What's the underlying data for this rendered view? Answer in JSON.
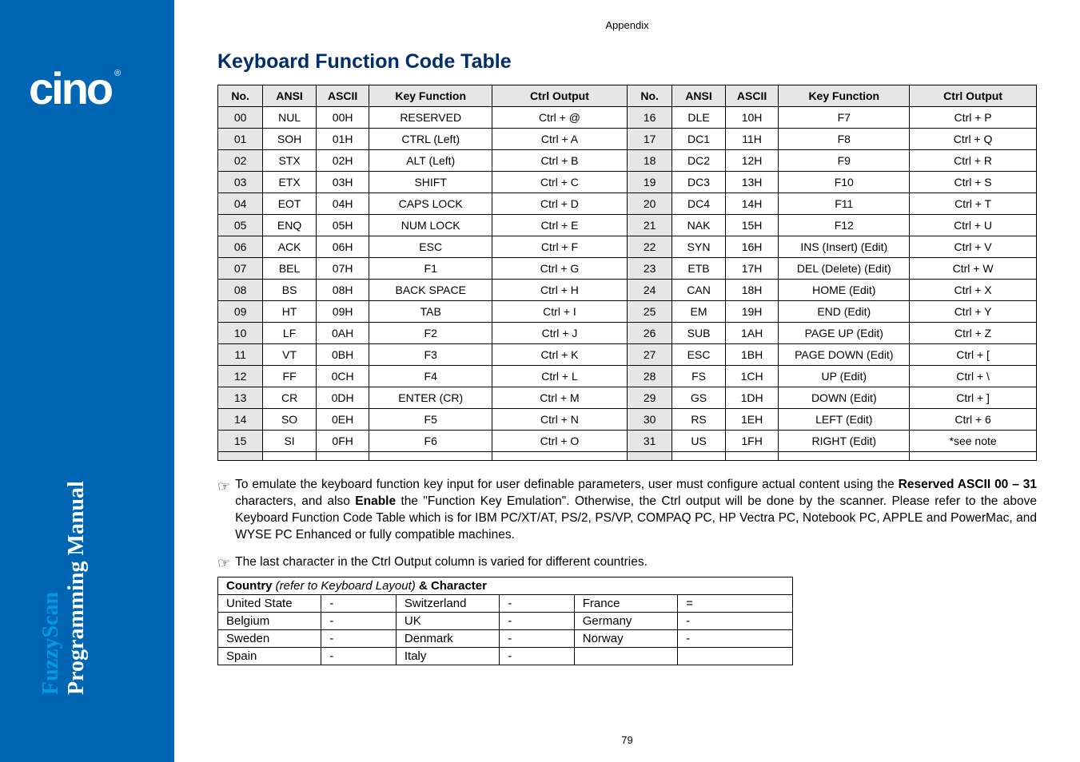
{
  "brand": "cino",
  "reg": "®",
  "manual_line1": "FuzzyScan",
  "manual_line2": "Programming Manual",
  "appendix": "Appendix",
  "title": "Keyboard Function Code Table",
  "headers": [
    "No.",
    "ANSI",
    "ASCII",
    "Key Function",
    "Ctrl Output",
    "No.",
    "ANSI",
    "ASCII",
    "Key Function",
    "Ctrl Output"
  ],
  "rows": [
    [
      "00",
      "NUL",
      "00H",
      "RESERVED",
      "Ctrl + @",
      "16",
      "DLE",
      "10H",
      "F7",
      "Ctrl + P"
    ],
    [
      "01",
      "SOH",
      "01H",
      "CTRL (Left)",
      "Ctrl + A",
      "17",
      "DC1",
      "11H",
      "F8",
      "Ctrl + Q"
    ],
    [
      "02",
      "STX",
      "02H",
      "ALT (Left)",
      "Ctrl + B",
      "18",
      "DC2",
      "12H",
      "F9",
      "Ctrl + R"
    ],
    [
      "03",
      "ETX",
      "03H",
      "SHIFT",
      "Ctrl + C",
      "19",
      "DC3",
      "13H",
      "F10",
      "Ctrl + S"
    ],
    [
      "04",
      "EOT",
      "04H",
      "CAPS LOCK",
      "Ctrl + D",
      "20",
      "DC4",
      "14H",
      "F11",
      "Ctrl + T"
    ],
    [
      "05",
      "ENQ",
      "05H",
      "NUM LOCK",
      "Ctrl + E",
      "21",
      "NAK",
      "15H",
      "F12",
      "Ctrl + U"
    ],
    [
      "06",
      "ACK",
      "06H",
      "ESC",
      "Ctrl + F",
      "22",
      "SYN",
      "16H",
      "INS (Insert) (Edit)",
      "Ctrl + V"
    ],
    [
      "07",
      "BEL",
      "07H",
      "F1",
      "Ctrl + G",
      "23",
      "ETB",
      "17H",
      "DEL (Delete) (Edit)",
      "Ctrl + W"
    ],
    [
      "08",
      "BS",
      "08H",
      "BACK SPACE",
      "Ctrl + H",
      "24",
      "CAN",
      "18H",
      "HOME (Edit)",
      "Ctrl + X"
    ],
    [
      "09",
      "HT",
      "09H",
      "TAB",
      "Ctrl + I",
      "25",
      "EM",
      "19H",
      "END (Edit)",
      "Ctrl + Y"
    ],
    [
      "10",
      "LF",
      "0AH",
      "F2",
      "Ctrl + J",
      "26",
      "SUB",
      "1AH",
      "PAGE UP (Edit)",
      "Ctrl + Z"
    ],
    [
      "11",
      "VT",
      "0BH",
      "F3",
      "Ctrl + K",
      "27",
      "ESC",
      "1BH",
      "PAGE DOWN (Edit)",
      "Ctrl + ["
    ],
    [
      "12",
      "FF",
      "0CH",
      "F4",
      "Ctrl + L",
      "28",
      "FS",
      "1CH",
      "UP (Edit)",
      "Ctrl + \\"
    ],
    [
      "13",
      "CR",
      "0DH",
      "ENTER (CR)",
      "Ctrl + M",
      "29",
      "GS",
      "1DH",
      "DOWN (Edit)",
      "Ctrl + ]"
    ],
    [
      "14",
      "SO",
      "0EH",
      "F5",
      "Ctrl + N",
      "30",
      "RS",
      "1EH",
      "LEFT (Edit)",
      "Ctrl + 6"
    ],
    [
      "15",
      "SI",
      "0FH",
      "F6",
      "Ctrl + O",
      "31",
      "US",
      "1FH",
      "RIGHT (Edit)",
      "*see note"
    ],
    [
      "",
      "",
      "",
      "",
      "",
      "",
      "",
      "",
      "",
      ""
    ]
  ],
  "note1_pre": "To emulate the keyboard function key input for user definable parameters, user must configure actual content using the ",
  "note1_b1": "Reserved ASCII 00 – 31",
  "note1_mid": " characters, and also ",
  "note1_b2": "Enable",
  "note1_post": " the \"Function Key Emulation\". Otherwise, the Ctrl output will be done by the scanner. Please refer to the above Keyboard Function Code Table which is for IBM PC/XT/AT, PS/2, PS/VP, COMPAQ PC, HP Vectra PC, Notebook PC, APPLE and PowerMac, and WYSE PC Enhanced or fully compatible machines.",
  "note2": "The last character in the Ctrl Output column is varied for different countries.",
  "country_header_b1": "Country",
  "country_header_i": " (refer to Keyboard Layout) ",
  "country_header_b2": "& Character",
  "country_rows": [
    [
      "United State",
      "-",
      "Switzerland",
      "-",
      "France",
      "="
    ],
    [
      "Belgium",
      "-",
      "UK",
      "-",
      "Germany",
      "-"
    ],
    [
      "Sweden",
      "-",
      "Denmark",
      "-",
      "Norway",
      "-"
    ],
    [
      "Spain",
      "-",
      "Italy",
      "-",
      "",
      ""
    ]
  ],
  "page_number": "79",
  "hand_glyph": "☞"
}
